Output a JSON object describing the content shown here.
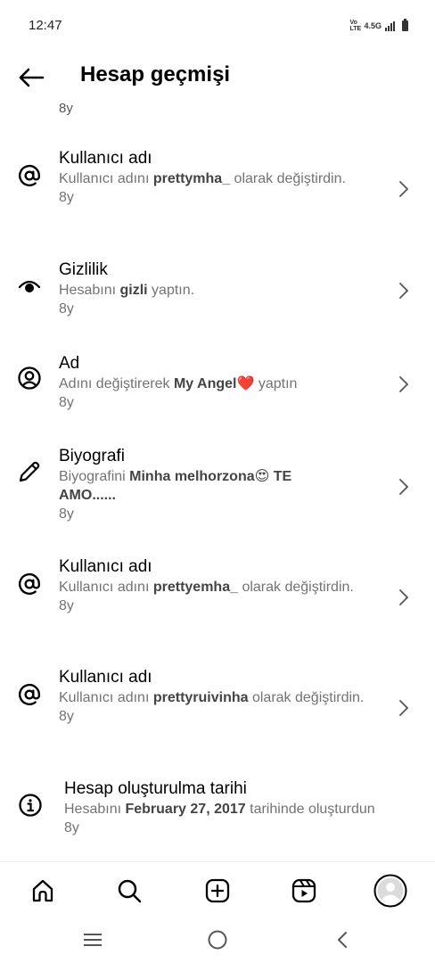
{
  "status_bar": {
    "time": "12:47",
    "volte": "VoLTE",
    "network": "4.5G"
  },
  "header": {
    "title": "Hesap geçmişi",
    "back_icon": "arrow-left-icon"
  },
  "partial_entry_time": "8y",
  "entries": [
    {
      "icon": "at-sign-icon",
      "title": "Kullanıcı adı",
      "desc_pre": "Kullanıcı adını ",
      "desc_bold": "prettymha_",
      "desc_post": " olarak değiştirdin.",
      "time": "8y"
    },
    {
      "icon": "eye-icon",
      "title": "Gizlilik",
      "desc_pre": "Hesabını ",
      "desc_bold": "gizli",
      "desc_post": " yaptın.",
      "time": "8y"
    },
    {
      "icon": "user-circle-icon",
      "title": "Ad",
      "desc_pre": "Adını değiştirerek ",
      "desc_bold": "My Angel❤️",
      "desc_post": " yaptın",
      "time": "8y"
    },
    {
      "icon": "pencil-icon",
      "title": "Biyografi",
      "desc_pre": "Biyografini ",
      "desc_bold": "Minha melhorzona😍 TE AMO......",
      "desc_post": "",
      "time": "8y"
    },
    {
      "icon": "at-sign-icon",
      "title": "Kullanıcı adı",
      "desc_pre": "Kullanıcı adını ",
      "desc_bold": "prettyemha_",
      "desc_post": " olarak değiştirdin.",
      "time": "8y"
    },
    {
      "icon": "at-sign-icon",
      "title": "Kullanıcı adı",
      "desc_pre": "Kullanıcı adını ",
      "desc_bold": "prettyruivinha",
      "desc_post": " olarak değiştirdin.",
      "time": "8y"
    },
    {
      "icon": "info-icon",
      "title": "Hesap oluşturulma tarihi",
      "desc_pre": "Hesabını ",
      "desc_bold": "February 27, 2017",
      "desc_post": " tarihinde oluşturdun",
      "time": "8y"
    }
  ],
  "bottom_nav": [
    "home-icon",
    "search-icon",
    "create-icon",
    "reels-icon",
    "profile-avatar"
  ],
  "system_nav": [
    "recents-icon",
    "home-circle-icon",
    "back-chevron-icon"
  ]
}
